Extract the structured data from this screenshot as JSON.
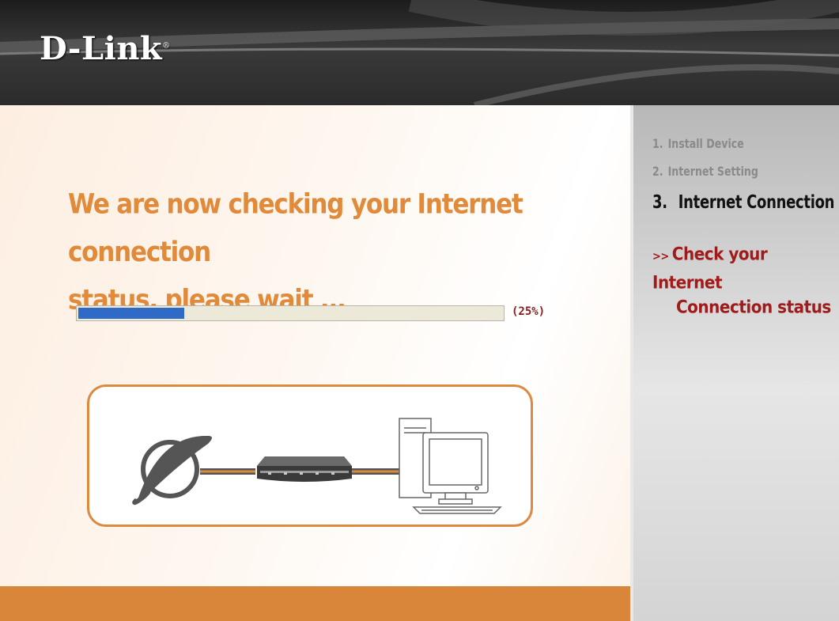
{
  "brand": {
    "logo_text": "D-Link",
    "trademark": "®"
  },
  "main": {
    "heading_line1": "We are now checking your Internet connection",
    "heading_line2": "status, please wait ...",
    "progress": {
      "percent": 25,
      "label": "(25%)"
    }
  },
  "sidebar": {
    "steps": [
      {
        "number": "1.",
        "label": "Install Device",
        "state": "done"
      },
      {
        "number": "2.",
        "label": "Internet Setting",
        "state": "done"
      },
      {
        "number": "3.",
        "label": "Internet Connection",
        "state": "current"
      }
    ],
    "substep": {
      "prefix": ">>",
      "line1": "Check your  Internet",
      "line2": "Connection status"
    }
  },
  "diagram": {
    "icons": [
      "internet-globe-icon",
      "router-icon",
      "computer-icon"
    ]
  },
  "colors": {
    "accent": "#e08a3a",
    "bottom_bar": "#d9853a",
    "progress_fill": "#2f6bc6",
    "substep": "#a01c1c"
  }
}
